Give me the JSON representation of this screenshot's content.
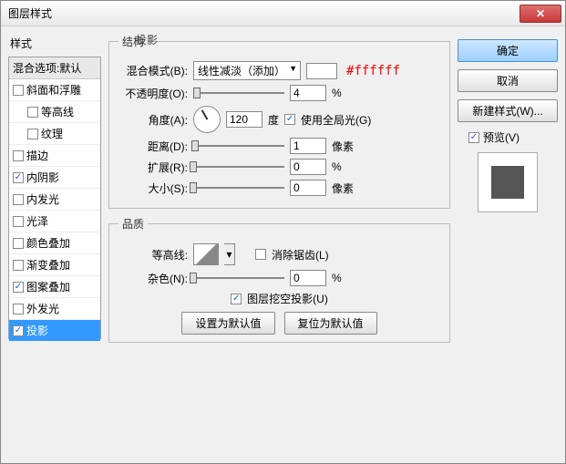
{
  "title": "图层样式",
  "close_icon": "✕",
  "left": {
    "label": "样式",
    "blend_header": "混合选项:默认",
    "items": [
      {
        "label": "斜面和浮雕",
        "checked": false,
        "indent": false
      },
      {
        "label": "等高线",
        "checked": false,
        "indent": true
      },
      {
        "label": "纹理",
        "checked": false,
        "indent": true
      },
      {
        "label": "描边",
        "checked": false,
        "indent": false
      },
      {
        "label": "内阴影",
        "checked": true,
        "indent": false
      },
      {
        "label": "内发光",
        "checked": false,
        "indent": false
      },
      {
        "label": "光泽",
        "checked": false,
        "indent": false
      },
      {
        "label": "颜色叠加",
        "checked": false,
        "indent": false
      },
      {
        "label": "渐变叠加",
        "checked": false,
        "indent": false
      },
      {
        "label": "图案叠加",
        "checked": true,
        "indent": false
      },
      {
        "label": "外发光",
        "checked": false,
        "indent": false
      },
      {
        "label": "投影",
        "checked": true,
        "indent": false,
        "selected": true
      }
    ]
  },
  "center": {
    "panel_title": "投影",
    "group1": "结构",
    "blend_mode_label": "混合模式(B):",
    "blend_mode_value": "线性减淡（添加）",
    "color_hex": "#ffffff",
    "opacity_label": "不透明度(O):",
    "opacity_value": "4",
    "pct": "%",
    "angle_label": "角度(A):",
    "angle_value": "120",
    "angle_unit": "度",
    "global_light": "使用全局光(G)",
    "distance_label": "距离(D):",
    "distance_value": "1",
    "px": "像素",
    "spread_label": "扩展(R):",
    "spread_value": "0",
    "size_label": "大小(S):",
    "size_value": "0",
    "group2": "品质",
    "contour_label": "等高线:",
    "antialias": "消除锯齿(L)",
    "noise_label": "杂色(N):",
    "noise_value": "0",
    "knockout": "图层挖空投影(U)",
    "btn_default": "设置为默认值",
    "btn_reset": "复位为默认值"
  },
  "right": {
    "ok": "确定",
    "cancel": "取消",
    "newstyle": "新建样式(W)...",
    "preview": "预览(V)"
  }
}
